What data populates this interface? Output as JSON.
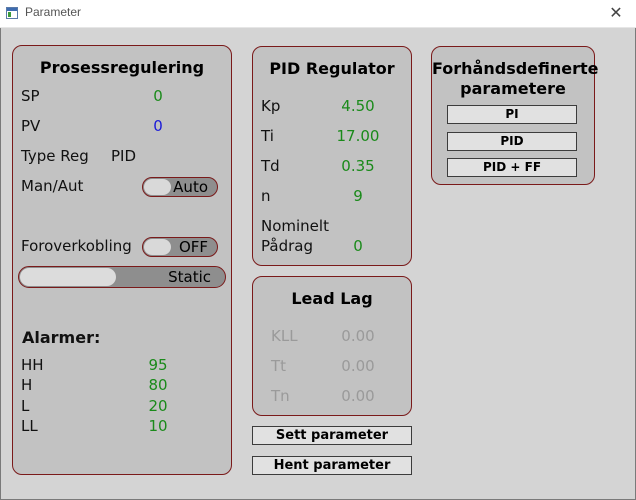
{
  "window": {
    "title": "Parameter",
    "close_glyph": "✕"
  },
  "prosess": {
    "heading": "Prosessregulering",
    "sp_label": "SP",
    "sp_value": "0",
    "pv_label": "PV",
    "pv_value": "0",
    "typereg_label": "Type Reg",
    "typereg_value": "PID",
    "manaut_label": "Man/Aut",
    "manaut_state": "Auto",
    "forover_label": "Foroverkobling",
    "forover_state": "OFF",
    "mode_state": "Static",
    "alarm_heading": "Alarmer:",
    "alarms": [
      {
        "label": "HH",
        "value": "95"
      },
      {
        "label": "H",
        "value": "80"
      },
      {
        "label": "L",
        "value": "20"
      },
      {
        "label": "LL",
        "value": "10"
      }
    ]
  },
  "pid": {
    "heading": "PID Regulator",
    "params": [
      {
        "label": "Kp",
        "value": "4.50"
      },
      {
        "label": "Ti",
        "value": "17.00"
      },
      {
        "label": "Td",
        "value": "0.35"
      },
      {
        "label": "n",
        "value": "9"
      }
    ],
    "nominelt_label": "Nominelt",
    "padrag_label": "Pådrag",
    "padrag_value": "0"
  },
  "leadlag": {
    "heading": "Lead Lag",
    "params": [
      {
        "label": "KLL",
        "value": "0.00"
      },
      {
        "label": "Tt",
        "value": "0.00"
      },
      {
        "label": "Tn",
        "value": "0.00"
      }
    ]
  },
  "predefined": {
    "heading_line1": "Forhåndsdefinerte",
    "heading_line2": "parametere",
    "buttons": [
      "PI",
      "PID",
      "PID + FF"
    ]
  },
  "actions": {
    "set_label": "Sett parameter",
    "get_label": "Hent parameter"
  },
  "colors": {
    "value_green": "#1a8a1a",
    "value_blue": "#1a1ad8",
    "disabled_gray": "#9a9a9a",
    "panel_border": "#7a1a1a"
  }
}
